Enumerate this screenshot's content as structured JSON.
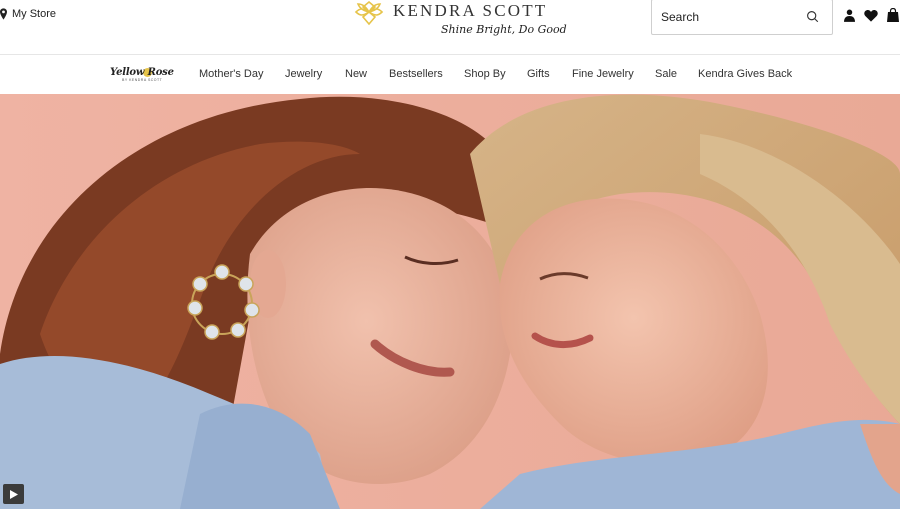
{
  "header": {
    "store_label": "My Store",
    "brand_name": "KENDRA SCOTT",
    "tagline": "Shine Bright, Do Good",
    "search_placeholder": "Search",
    "icons": [
      "account-icon",
      "heart-icon",
      "bag-icon"
    ]
  },
  "nav": {
    "sub_brand": "Yellow Rose",
    "sub_brand_small": "BY KENDRA SCOTT",
    "items": [
      "Mother's Day",
      "Jewelry",
      "New",
      "Bestsellers",
      "Shop By",
      "Gifts",
      "Fine Jewelry",
      "Sale",
      "Kendra Gives Back"
    ]
  },
  "hero": {
    "media": "photo of two smiling women touching foreheads, one wearing a statement earring",
    "control": "play-icon"
  },
  "colors": {
    "accent_gold": "#e6c44a",
    "hero_background": "#efb7a6",
    "sweater_blue": "#9fb6d6"
  }
}
